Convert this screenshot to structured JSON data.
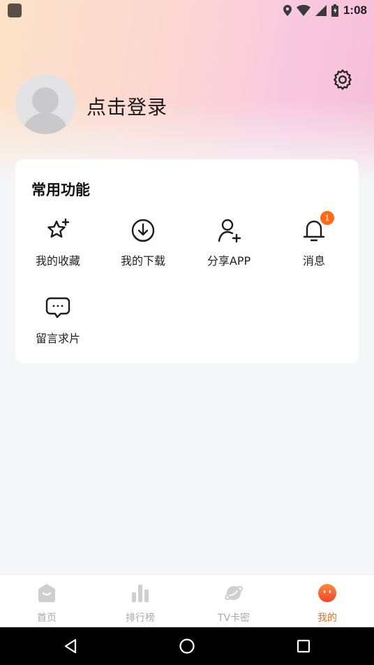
{
  "status_bar": {
    "time": "1:08"
  },
  "profile": {
    "login_text": "点击登录"
  },
  "functions": {
    "title": "常用功能",
    "items": [
      {
        "label": "我的收藏",
        "icon": "star-plus-icon"
      },
      {
        "label": "我的下载",
        "icon": "download-icon"
      },
      {
        "label": "分享APP",
        "icon": "add-user-icon"
      },
      {
        "label": "消息",
        "icon": "bell-icon",
        "badge": "1"
      },
      {
        "label": "留言求片",
        "icon": "chat-bubble-icon"
      }
    ]
  },
  "bottom_nav": {
    "items": [
      {
        "label": "首页",
        "icon": "home-icon",
        "active": false
      },
      {
        "label": "排行榜",
        "icon": "bar-chart-icon",
        "active": false
      },
      {
        "label": "TV卡密",
        "icon": "planet-icon",
        "active": false
      },
      {
        "label": "我的",
        "icon": "profile-face-icon",
        "active": true
      }
    ]
  },
  "colors": {
    "accent": "#f26a16",
    "badge": "#ff6a1a",
    "inactive": "#aaaaaa"
  }
}
